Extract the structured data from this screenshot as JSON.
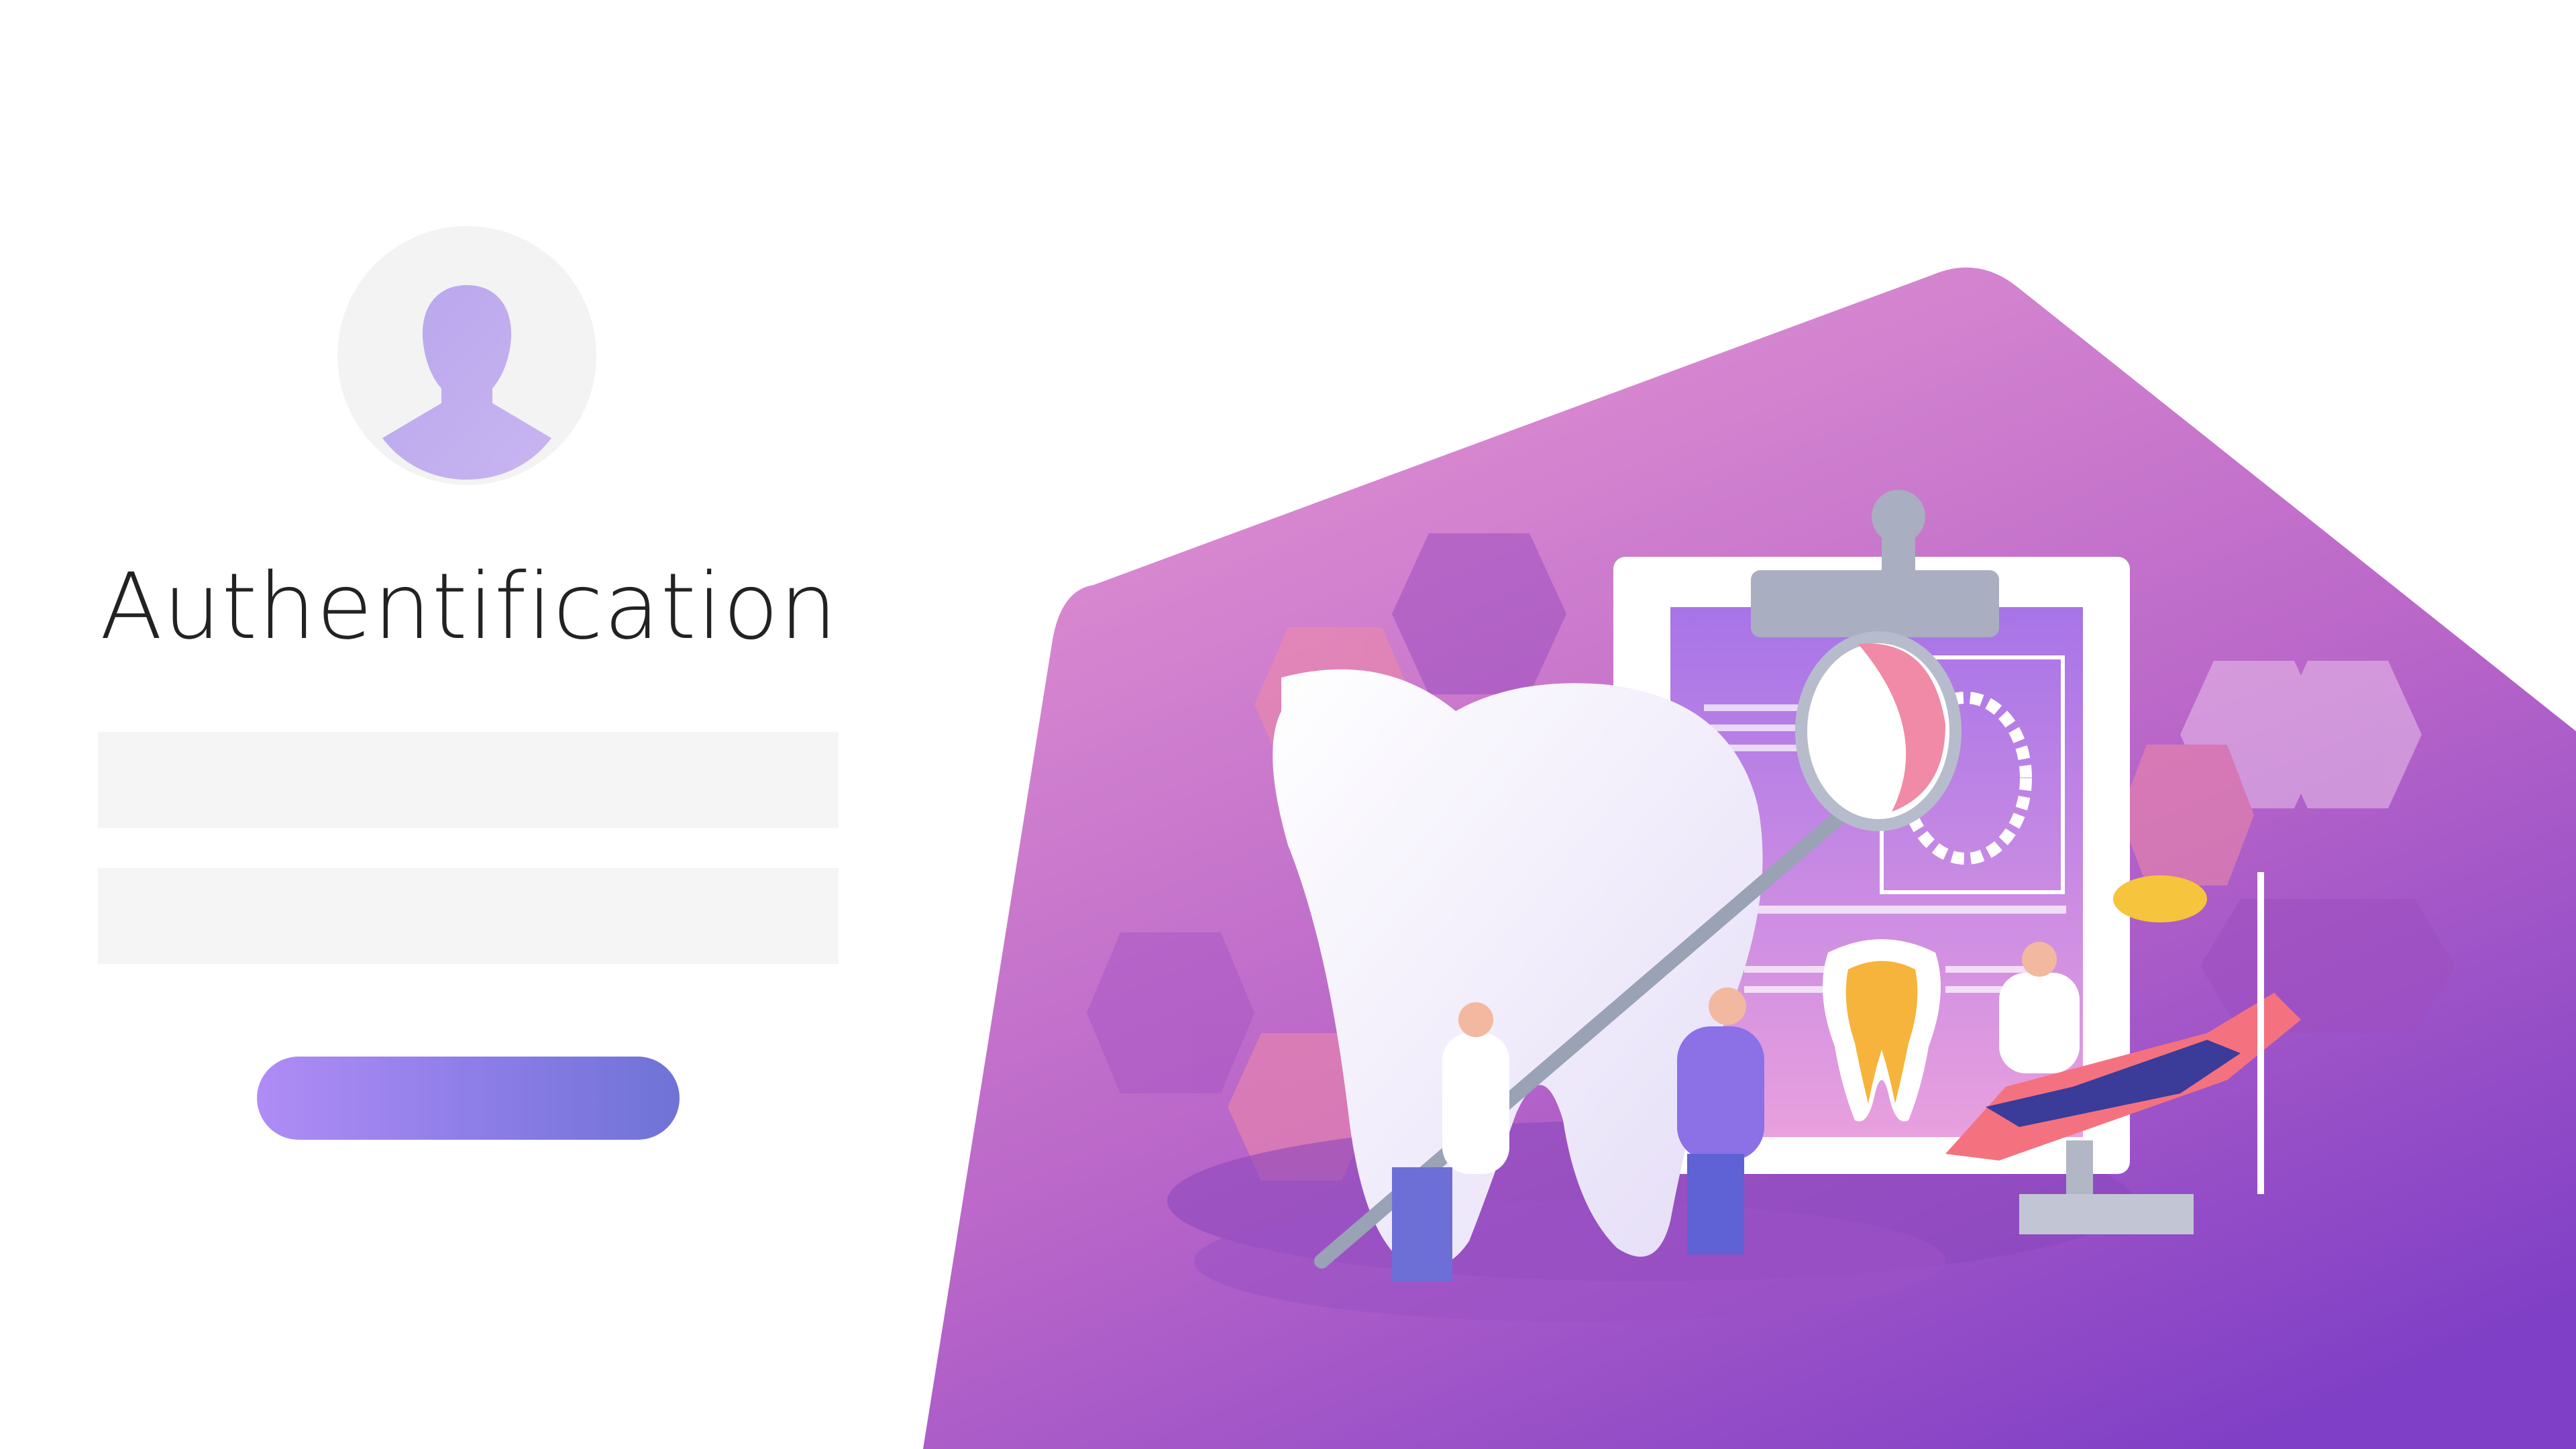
{
  "page": {
    "title": "Authentification"
  },
  "form": {
    "username_value": "",
    "username_placeholder": "",
    "password_value": "",
    "password_placeholder": "",
    "submit_label": ""
  },
  "icons": {
    "avatar": "user-silhouette-icon",
    "illustration": "dental-care-illustration"
  },
  "colors": {
    "accent_start": "#b08cf5",
    "accent_end": "#6f73d6",
    "hero_top": "#e08fcf",
    "hero_bottom": "#8a45c8"
  }
}
